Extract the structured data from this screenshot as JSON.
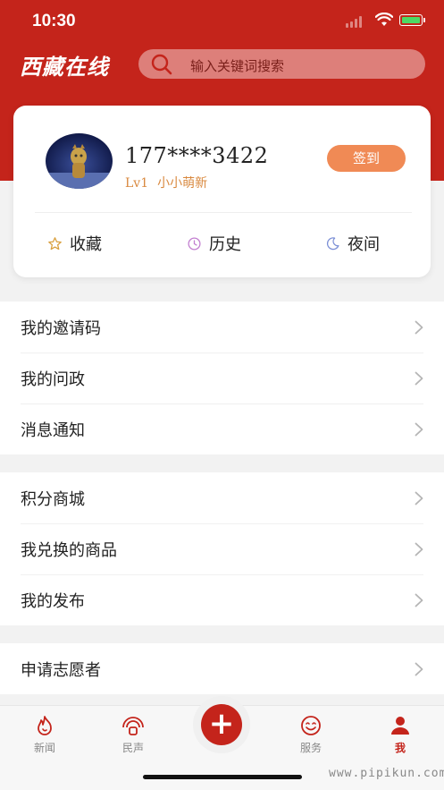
{
  "status_bar": {
    "time": "10:30"
  },
  "header": {
    "logo": "西藏在线",
    "search": {
      "placeholder": "输入关键词搜索",
      "icon": "search-icon"
    }
  },
  "profile": {
    "username": "177****3422",
    "level": "Lv1",
    "level_title": "小小萌新",
    "checkin_label": "签到",
    "quick_actions": [
      {
        "label": "收藏",
        "icon": "star-icon"
      },
      {
        "label": "历史",
        "icon": "clock-icon"
      },
      {
        "label": "夜间",
        "icon": "moon-icon"
      }
    ]
  },
  "menu_groups": [
    {
      "items": [
        {
          "label": "我的邀请码"
        },
        {
          "label": "我的问政"
        },
        {
          "label": "消息通知"
        }
      ]
    },
    {
      "items": [
        {
          "label": "积分商城"
        },
        {
          "label": "我兑换的商品"
        },
        {
          "label": "我的发布"
        }
      ]
    },
    {
      "items": [
        {
          "label": "申请志愿者"
        }
      ]
    }
  ],
  "tab_bar": {
    "tabs": [
      {
        "label": "新闻",
        "icon": "flame-icon"
      },
      {
        "label": "民声",
        "icon": "megaphone-icon"
      },
      {
        "label": "服务",
        "icon": "smile-icon"
      },
      {
        "label": "我",
        "icon": "person-icon",
        "active": true
      }
    ],
    "center_button": {
      "label": "+"
    }
  },
  "watermark": "www.pipikun.com",
  "colors": {
    "brand": "#c4241b",
    "accent": "#f08a55",
    "level": "#d9893f"
  }
}
